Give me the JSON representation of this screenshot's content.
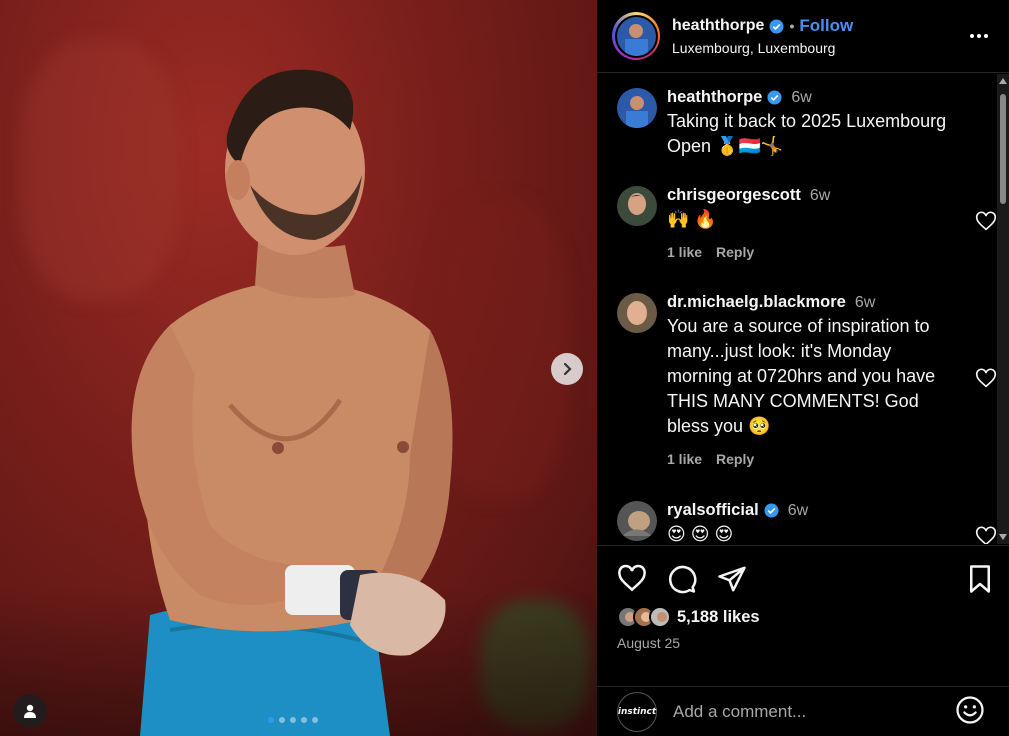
{
  "post": {
    "author": "heaththorpe",
    "follow_label": "Follow",
    "separator": "•",
    "location": "Luxembourg, Luxembourg",
    "carousel_total": 5,
    "carousel_active": 1
  },
  "caption": {
    "username": "heaththorpe",
    "time": "6w",
    "text": "Taking it back to 2025 Luxembourg Open 🥇🇱🇺🤸"
  },
  "comments": [
    {
      "username": "chrisgeorgescott",
      "time": "6w",
      "text": "🙌 🔥",
      "likes": "1 like",
      "reply": "Reply",
      "verified": false
    },
    {
      "username": "dr.michaelg.blackmore",
      "time": "6w",
      "text": "You are a source of inspiration to many...just look: it's Monday morning at 0720hrs and you have THIS MANY COMMENTS! God bless you 🥺",
      "likes": "1 like",
      "reply": "Reply",
      "verified": false
    },
    {
      "username": "ryalsofficial",
      "time": "6w",
      "text": "😍 😍 😍",
      "verified": true
    }
  ],
  "stats": {
    "likes": "5,188 likes",
    "date": "August 25"
  },
  "add_comment": {
    "placeholder": "Add a comment...",
    "avatar_text": "instinct"
  },
  "colors": {
    "accent": "#4a8ff7",
    "verified": "#3897f0",
    "background": "#000000",
    "muted": "#a8a8a8"
  }
}
